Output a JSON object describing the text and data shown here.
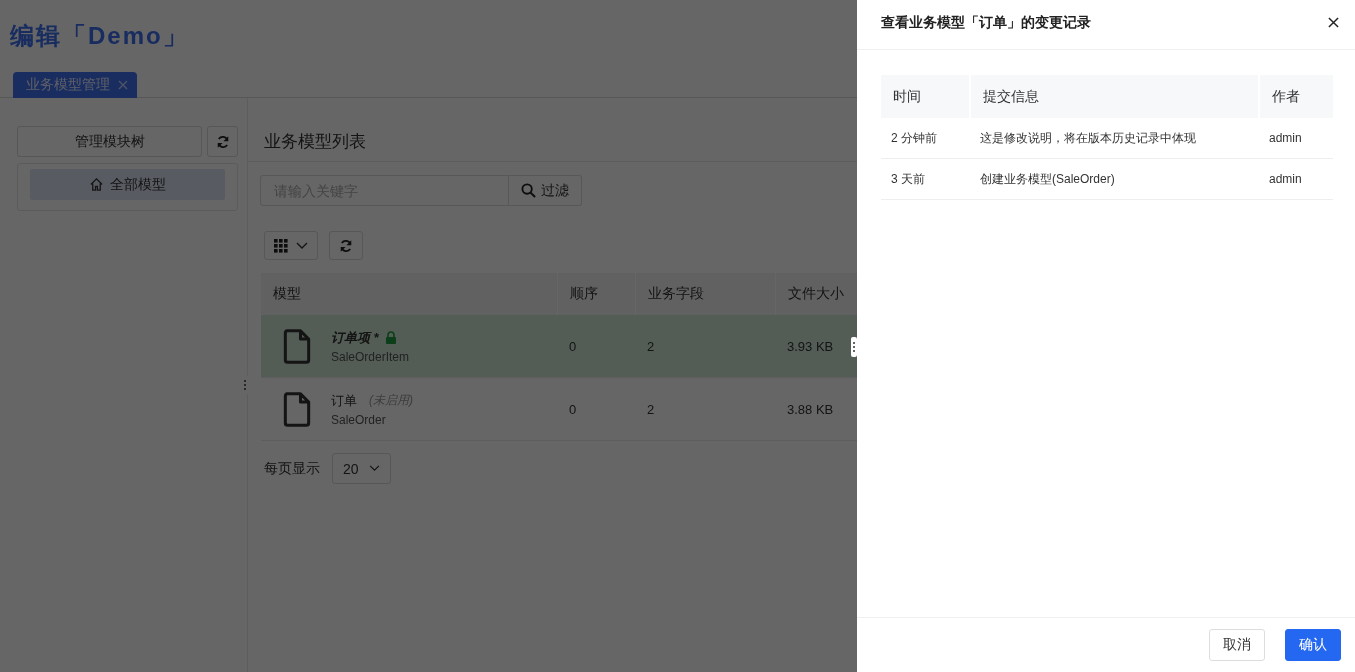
{
  "page": {
    "title": "编辑「Demo」",
    "tabs": [
      {
        "label": "业务模型管理",
        "selected": true
      }
    ]
  },
  "sidebar": {
    "manage_button": "管理模块树",
    "tree": [
      {
        "label": "全部模型",
        "selected": true
      }
    ]
  },
  "list": {
    "title": "业务模型列表",
    "search": {
      "placeholder": "请输入关键字"
    },
    "filter_button": "过滤",
    "columns": [
      "模型",
      "顺序",
      "业务字段",
      "文件大小"
    ],
    "rows": [
      {
        "name": "订单项 *",
        "code": "SaleOrderItem",
        "modified": true,
        "locked": true,
        "order": "0",
        "fields": "2",
        "size": "3.93 KB",
        "selected": true
      },
      {
        "name": "订单",
        "note": "(未启用)",
        "code": "SaleOrder",
        "modified": false,
        "locked": false,
        "order": "0",
        "fields": "2",
        "size": "3.88 KB",
        "selected": false
      }
    ],
    "pagination": {
      "label": "每页显示",
      "page_size": "20"
    }
  },
  "drawer": {
    "title": "查看业务模型「订单」的变更记录",
    "columns": [
      "时间",
      "提交信息",
      "作者"
    ],
    "rows": [
      {
        "time": "2 分钟前",
        "message": "这是修改说明，将在版本历史记录中体现",
        "author": "admin"
      },
      {
        "time": "3 天前",
        "message": "创建业务模型(SaleOrder)",
        "author": "admin"
      }
    ],
    "buttons": [
      {
        "label": "取消",
        "kind": "default"
      },
      {
        "label": "确认",
        "kind": "primary"
      }
    ]
  }
}
